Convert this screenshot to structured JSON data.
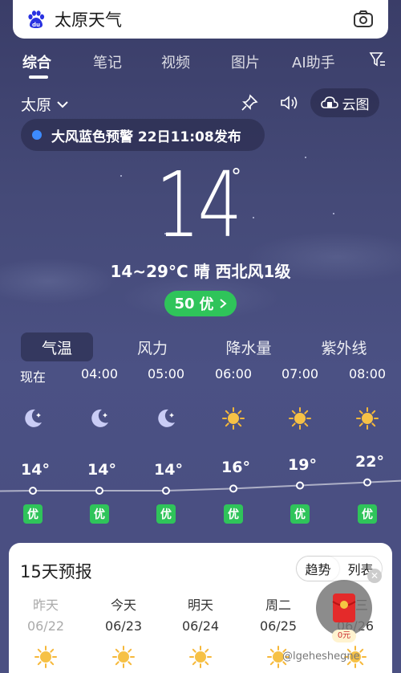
{
  "search": {
    "query": "太原天气"
  },
  "tabs": [
    "综合",
    "笔记",
    "视频",
    "图片",
    "AI助手"
  ],
  "location": {
    "city": "太原",
    "cloud_map": "云图"
  },
  "alert": {
    "text": "大风蓝色预警 22日11:08发布",
    "color": "#3d8bff"
  },
  "current": {
    "temperature": "14",
    "degree_symbol": "°",
    "summary": "14~29°C 晴 西北风1级",
    "aqi_value": "50",
    "aqi_label": "优",
    "aqi_color": "#2fc45a"
  },
  "metric_tabs": [
    "气温",
    "风力",
    "降水量",
    "紫外线"
  ],
  "hourly": [
    {
      "time": "现在",
      "icon": "moon-icon",
      "temp": "14°",
      "temp_value": 14,
      "aqi": "优"
    },
    {
      "time": "04:00",
      "icon": "moon-icon",
      "temp": "14°",
      "temp_value": 14,
      "aqi": "优"
    },
    {
      "time": "05:00",
      "icon": "moon-icon",
      "temp": "14°",
      "temp_value": 14,
      "aqi": "优"
    },
    {
      "time": "06:00",
      "icon": "sun-icon",
      "temp": "16°",
      "temp_value": 16,
      "aqi": "优"
    },
    {
      "time": "07:00",
      "icon": "sun-icon",
      "temp": "19°",
      "temp_value": 19,
      "aqi": "优"
    },
    {
      "time": "08:00",
      "icon": "sun-icon",
      "temp": "22°",
      "temp_value": 22,
      "aqi": "优"
    }
  ],
  "forecast": {
    "title": "15天预报",
    "toggle": [
      "趋势",
      "列表"
    ],
    "days": [
      {
        "name": "昨天",
        "date": "06/22",
        "icon": "sun-icon"
      },
      {
        "name": "今天",
        "date": "06/23",
        "icon": "sun-icon"
      },
      {
        "name": "明天",
        "date": "06/24",
        "icon": "sun-icon"
      },
      {
        "name": "周二",
        "date": "06/25",
        "icon": "sun-icon"
      },
      {
        "name": "周三",
        "date": "06/26",
        "icon": "sun-icon"
      }
    ]
  },
  "promo": {
    "amount": "0元"
  },
  "watermark": "@lgeheshegne"
}
